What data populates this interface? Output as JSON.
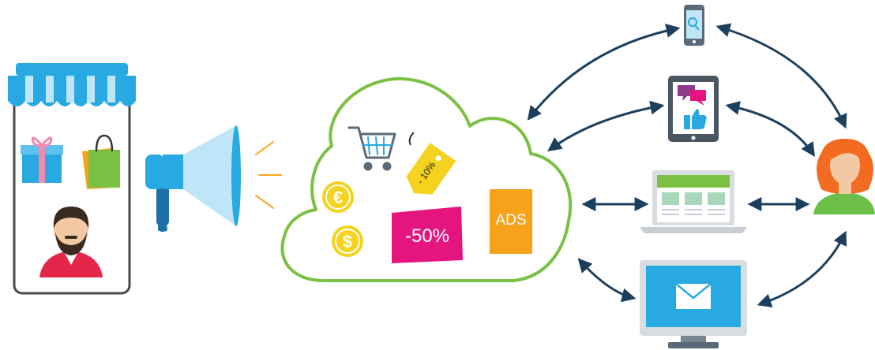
{
  "labels": {
    "discount_tag": "- 10%",
    "discount_sign": "-50%",
    "ads_block": "ADS"
  },
  "icons": [
    "shop-awning-icon",
    "gift-box-icon",
    "shopping-bag-icon",
    "shopkeeper-avatar-icon",
    "megaphone-icon",
    "cloud-icon",
    "shopping-cart-icon",
    "price-tag-icon",
    "euro-coin-icon",
    "dollar-coin-icon",
    "smartphone-search-icon",
    "tablet-social-icon",
    "laptop-website-icon",
    "desktop-email-icon",
    "customer-avatar-icon"
  ],
  "colors": {
    "shop_awning": "#29a9e1",
    "cloud_outline": "#7ac143",
    "magenta_sign": "#e4157f",
    "ads_orange": "#f7a21b",
    "coin_yellow": "#f4d21e",
    "arrow_navy": "#1d3f5e",
    "customer_hair": "#f26b21",
    "customer_shirt": "#6cc04a",
    "shopkeeper_shirt": "#e3274a"
  }
}
